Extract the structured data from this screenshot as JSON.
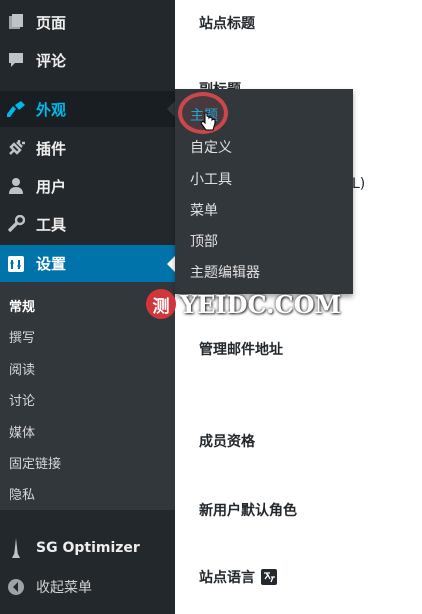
{
  "sidebar": {
    "items": [
      {
        "label": "页面",
        "icon": "pages-icon"
      },
      {
        "label": "评论",
        "icon": "comments-icon"
      },
      {
        "label": "外观",
        "icon": "appearance-icon"
      },
      {
        "label": "插件",
        "icon": "plugins-icon"
      },
      {
        "label": "用户",
        "icon": "users-icon"
      },
      {
        "label": "工具",
        "icon": "tools-icon"
      },
      {
        "label": "设置",
        "icon": "settings-icon"
      }
    ],
    "submenu": [
      "常规",
      "撰写",
      "阅读",
      "讨论",
      "媒体",
      "固定链接",
      "隐私"
    ],
    "optimizer_label": "SG Optimizer",
    "collapse_label": "收起菜单"
  },
  "flyout": {
    "items": [
      "主题",
      "自定义",
      "小工具",
      "菜单",
      "顶部",
      "主题编辑器"
    ]
  },
  "main": {
    "labels": [
      "站点标题",
      "副标题",
      "管理邮件地址",
      "成员资格",
      "新用户默认角色",
      "站点语言"
    ],
    "partial_text": "L)"
  },
  "watermark": {
    "circle_char": "测",
    "text": "YEIDC.COM"
  },
  "colors": {
    "sidebar_bg": "#23282d",
    "submenu_bg": "#32373c",
    "current_bg": "#0073aa",
    "flyout_active": "#00b9eb"
  }
}
